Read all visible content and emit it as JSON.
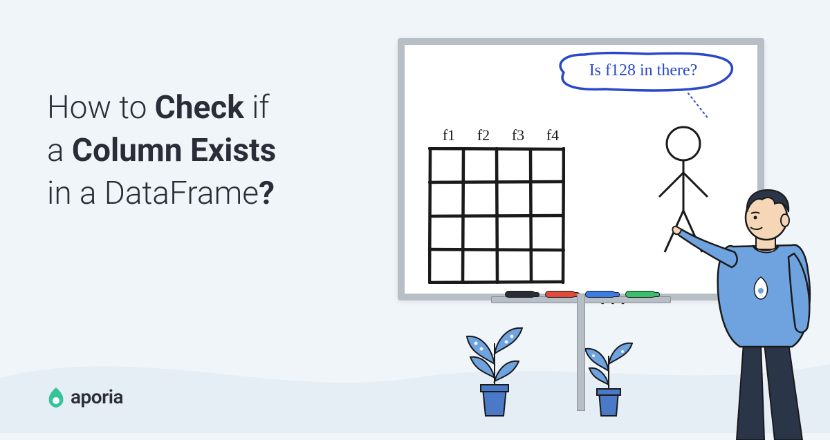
{
  "title": {
    "line1_pre": "How to ",
    "line1_bold": "Check",
    "line1_post": " if",
    "line2_pre": "a ",
    "line2_bold": "Column Exists",
    "line3_pre": "in a DataFrame",
    "line3_bold": "?"
  },
  "whiteboard": {
    "bubble_text": "Is f128 in there?",
    "headers": [
      "f1",
      "f2",
      "f3",
      "f4"
    ],
    "ellipsis": "..."
  },
  "logo": {
    "text": "aporia"
  }
}
